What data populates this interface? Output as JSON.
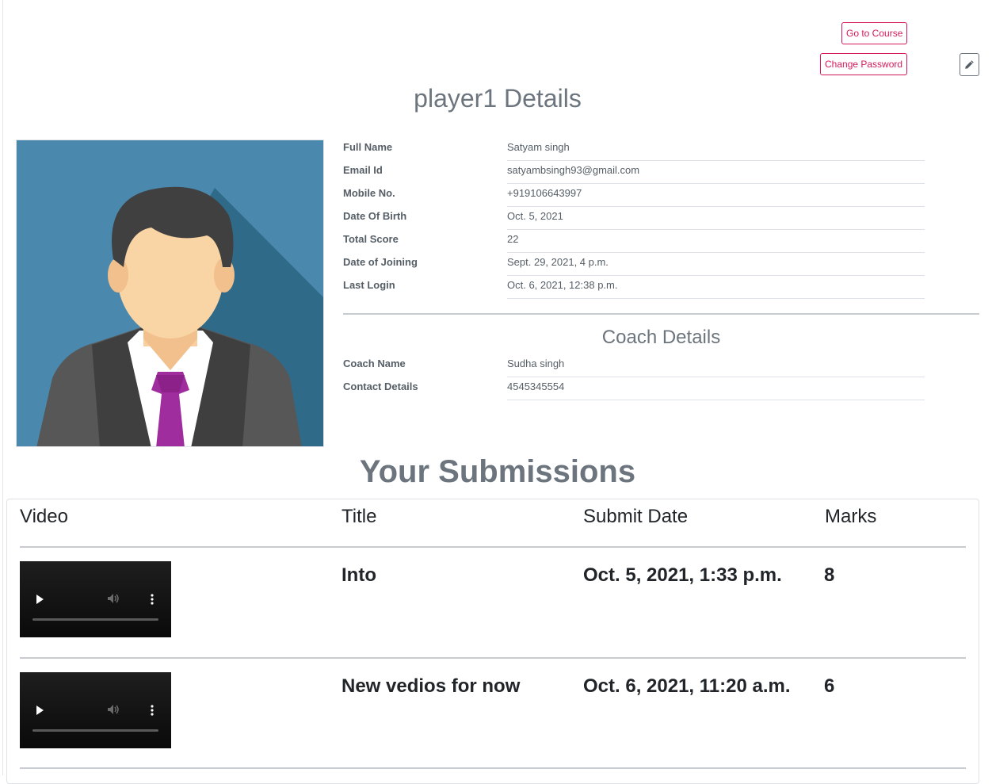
{
  "header": {
    "go_to_course": "Go to Course",
    "change_password": "Change Password",
    "page_title": "player1 Details"
  },
  "profile": {
    "full_name_label": "Full Name",
    "full_name": "Satyam singh",
    "email_label": "Email Id",
    "email": "satyambsingh93@gmail.com",
    "mobile_label": "Mobile No.",
    "mobile": "+919106643997",
    "dob_label": "Date Of Birth",
    "dob": "Oct. 5, 2021",
    "score_label": "Total Score",
    "score": "22",
    "joining_label": "Date of Joining",
    "joining": "Sept. 29, 2021, 4 p.m.",
    "login_label": "Last Login",
    "login": "Oct. 6, 2021, 12:38 p.m."
  },
  "coach": {
    "title": "Coach Details",
    "name_label": "Coach Name",
    "name": "Sudha singh",
    "contact_label": "Contact Details",
    "contact": "4545345554"
  },
  "submissions": {
    "title": "Your Submissions",
    "headers": [
      "Video",
      "Title",
      "Submit Date",
      "Marks"
    ],
    "rows": [
      {
        "title": "Into",
        "date": "Oct. 5, 2021, 1:33 p.m.",
        "marks": "8"
      },
      {
        "title": "New vedios for now",
        "date": "Oct. 6, 2021, 11:20 a.m.",
        "marks": "6"
      }
    ]
  },
  "colors": {
    "accent": "#d6195a",
    "avatar_bg": "#4a89ad",
    "tie": "#a02d9e"
  },
  "icons": [
    "pencil-icon",
    "play-icon",
    "volume-icon",
    "more-vertical-icon"
  ]
}
